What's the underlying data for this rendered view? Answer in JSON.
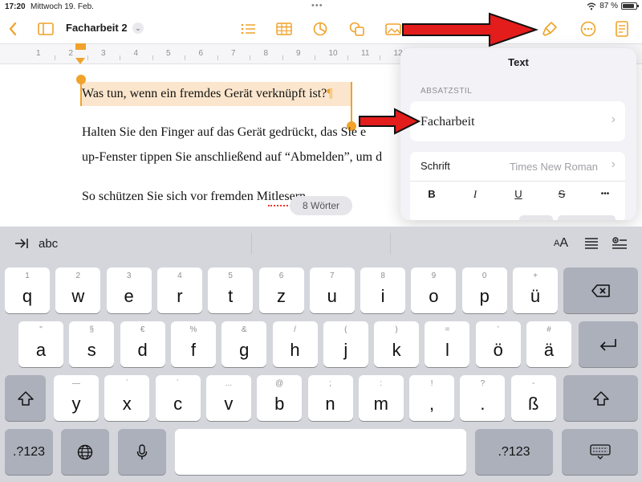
{
  "status_bar": {
    "time": "17:20",
    "date": "Mittwoch 19. Feb.",
    "battery_text": "87 %",
    "battery_level": 0.87
  },
  "toolbar": {
    "doc_title": "Facharbeit 2",
    "accent_color": "#f0a22a"
  },
  "ruler": {
    "numbers": [
      "1",
      "2",
      "3",
      "4",
      "5",
      "6",
      "7",
      "8",
      "9",
      "10",
      "11",
      "12"
    ]
  },
  "document": {
    "paragraphs": [
      "Was tun, wenn ein fremdes Gerät verknüpft ist?",
      "Halten Sie den Finger auf das Gerät gedrückt, das Sie e",
      "up-Fenster tippen Sie anschließend auf “Abmelden”, um d",
      "So schützen Sie sich vor fremden Mitlesern"
    ],
    "pilcrow": "¶",
    "word_count": "8 Wörter"
  },
  "popover": {
    "title": "Text",
    "section_label": "ABSATZSTIL",
    "paragraph_style": "Facharbeit",
    "font_label": "Schrift",
    "font_value": "Times New Roman",
    "format_buttons": [
      "B",
      "I",
      "U",
      "S",
      "•••"
    ]
  },
  "shortcut_bar": {
    "tab_text": "abc"
  },
  "keyboard": {
    "row1": [
      {
        "alt": "1",
        "main": "q"
      },
      {
        "alt": "2",
        "main": "w"
      },
      {
        "alt": "3",
        "main": "e"
      },
      {
        "alt": "4",
        "main": "r"
      },
      {
        "alt": "5",
        "main": "t"
      },
      {
        "alt": "6",
        "main": "z"
      },
      {
        "alt": "7",
        "main": "u"
      },
      {
        "alt": "8",
        "main": "i"
      },
      {
        "alt": "9",
        "main": "o"
      },
      {
        "alt": "0",
        "main": "p"
      },
      {
        "alt": "+",
        "main": "ü"
      }
    ],
    "row2": [
      {
        "alt": "\"",
        "main": "a"
      },
      {
        "alt": "§",
        "main": "s"
      },
      {
        "alt": "€",
        "main": "d"
      },
      {
        "alt": "%",
        "main": "f"
      },
      {
        "alt": "&",
        "main": "g"
      },
      {
        "alt": "/",
        "main": "h"
      },
      {
        "alt": "(",
        "main": "j"
      },
      {
        "alt": ")",
        "main": "k"
      },
      {
        "alt": "=",
        "main": "l"
      },
      {
        "alt": "’",
        "main": "ö"
      },
      {
        "alt": "#",
        "main": "ä"
      }
    ],
    "row3": [
      {
        "alt": "—",
        "main": "y"
      },
      {
        "alt": "`",
        "main": "x"
      },
      {
        "alt": "´",
        "main": "c"
      },
      {
        "alt": "...",
        "main": "v"
      },
      {
        "alt": "@",
        "main": "b"
      },
      {
        "alt": ";",
        "main": "n"
      },
      {
        "alt": ":",
        "main": "m"
      },
      {
        "alt": "!",
        "main": ","
      },
      {
        "alt": "?",
        "main": "."
      },
      {
        "alt": "-",
        "main": "ß"
      }
    ],
    "numbers_label": ".?123"
  }
}
